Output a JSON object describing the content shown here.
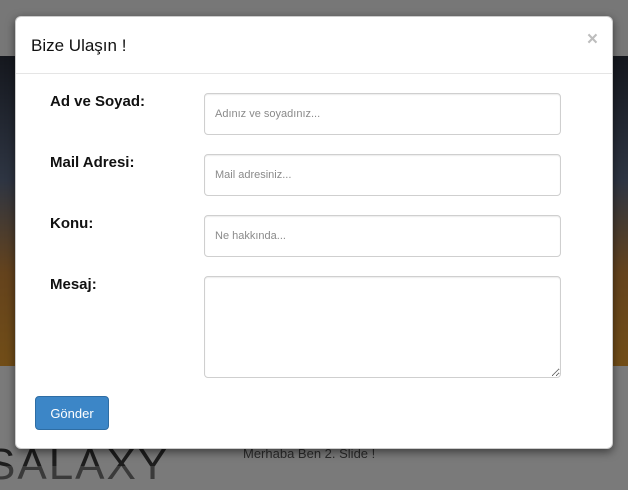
{
  "background": {
    "big_text": "SALAXY",
    "small_text": "Merhaba Ben 2. Slide !"
  },
  "modal": {
    "title": "Bize Ulaşın !",
    "close_symbol": "×",
    "fields": {
      "name": {
        "label": "Ad ve Soyad:",
        "placeholder": "Adınız ve soyadınız..."
      },
      "email": {
        "label": "Mail Adresi:",
        "placeholder": "Mail adresiniz..."
      },
      "subject": {
        "label": "Konu:",
        "placeholder": "Ne hakkında..."
      },
      "message": {
        "label": "Mesaj:",
        "value": ""
      }
    },
    "submit_label": "Gönder"
  },
  "colors": {
    "primary_button": "#3c86c7",
    "overlay": "rgba(0,0,0,0.5)"
  }
}
